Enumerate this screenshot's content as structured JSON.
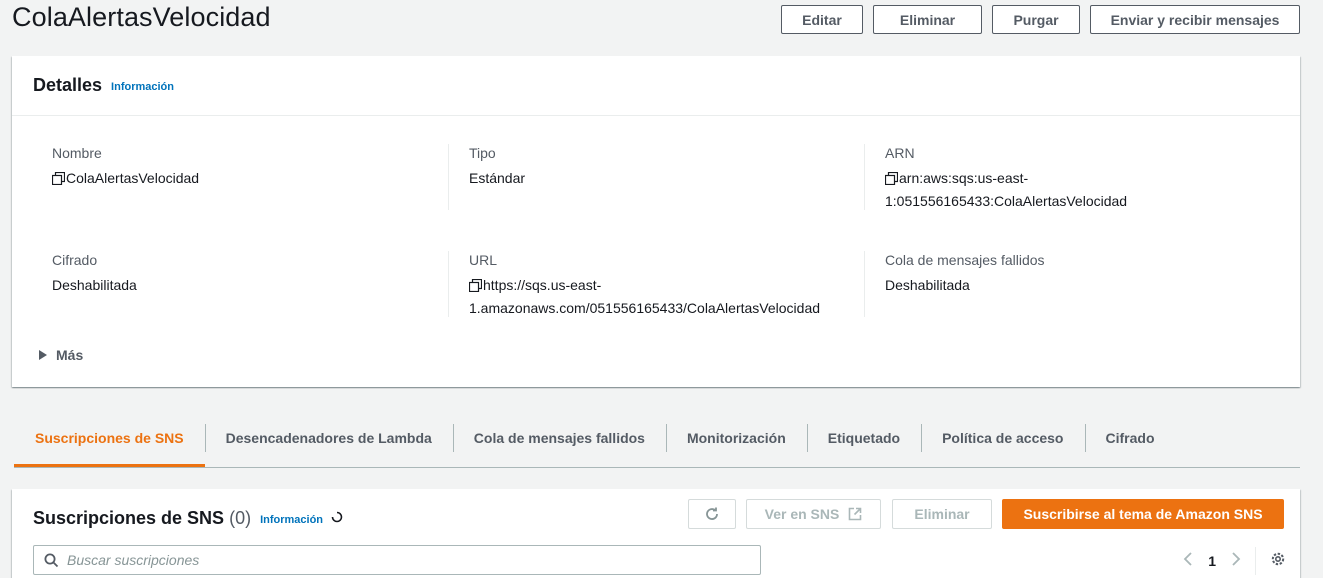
{
  "page": {
    "title": "ColaAlertasVelocidad",
    "actions": {
      "edit": "Editar",
      "delete": "Eliminar",
      "purge": "Purgar",
      "send_receive": "Enviar y recibir mensajes"
    }
  },
  "details": {
    "title": "Detalles",
    "info": "Información",
    "name_label": "Nombre",
    "name_value": "ColaAlertasVelocidad",
    "type_label": "Tipo",
    "type_value": "Estándar",
    "arn_label": "ARN",
    "arn_line1": "arn:aws:sqs:us-east-",
    "arn_line2": "1:051556165433:ColaAlertasVelocidad",
    "encryption_label": "Cifrado",
    "encryption_value": "Deshabilitada",
    "url_label": "URL",
    "url_line1": "https://sqs.us-east-",
    "url_line2": "1.amazonaws.com/051556165433/ColaAlertasVelocidad",
    "dlq_label": "Cola de mensajes fallidos",
    "dlq_value": "Deshabilitada",
    "more": "Más"
  },
  "tabs": [
    {
      "label": "Suscripciones de SNS"
    },
    {
      "label": "Desencadenadores de Lambda"
    },
    {
      "label": "Cola de mensajes fallidos"
    },
    {
      "label": "Monitorización"
    },
    {
      "label": "Etiquetado"
    },
    {
      "label": "Política de acceso"
    },
    {
      "label": "Cifrado"
    }
  ],
  "active_tab": "Suscripciones de SNS",
  "subscriptions": {
    "title": "Suscripciones de SNS",
    "count": "(0)",
    "info": "Información",
    "view_in_sns": "Ver en SNS",
    "delete": "Eliminar",
    "subscribe": "Suscribirse al tema de Amazon SNS",
    "search_placeholder": "Buscar suscripciones",
    "page_number": "1"
  },
  "colors": {
    "accent": "#ec7211",
    "link": "#0073bb",
    "text": "#16191f",
    "secondary_text": "#545b64"
  },
  "icons": [
    "copy-icon",
    "caret-right-icon",
    "refresh-icon",
    "external-link-icon",
    "spinner-icon",
    "search-icon",
    "chevron-left-icon",
    "chevron-right-icon",
    "gear-icon"
  ]
}
